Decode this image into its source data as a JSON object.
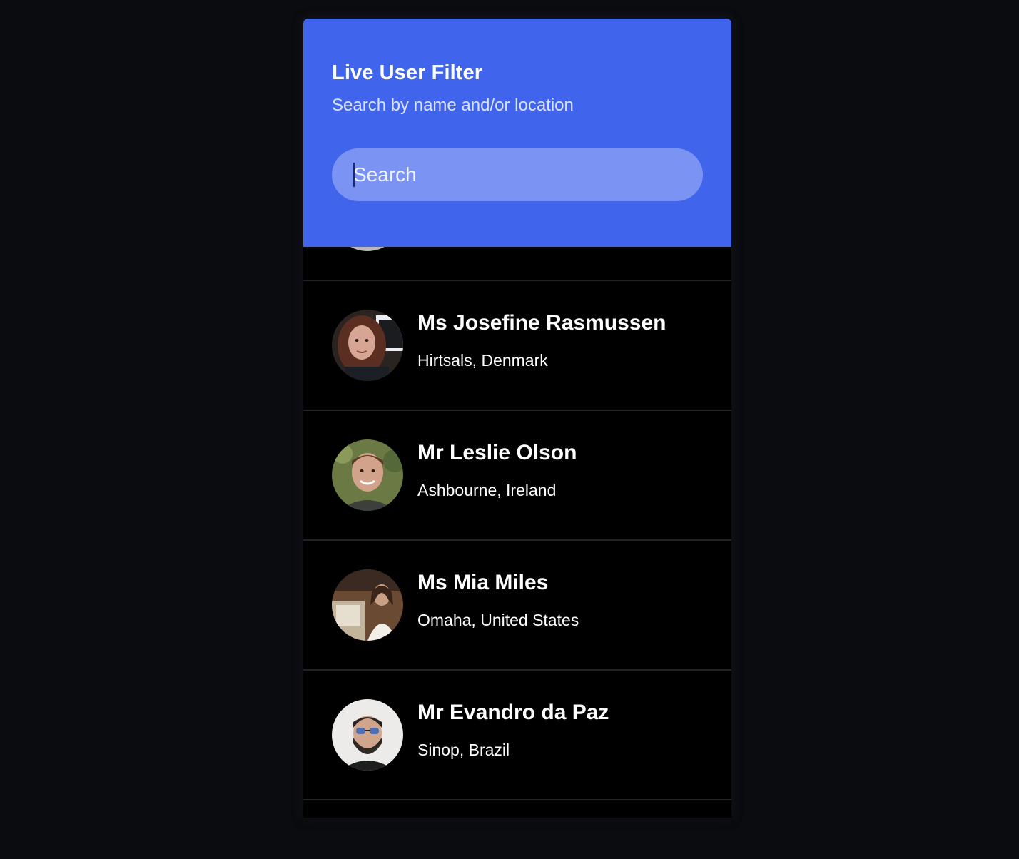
{
  "header": {
    "title": "Live User Filter",
    "subtitle": "Search by name and/or location"
  },
  "search": {
    "placeholder": "Search",
    "value": ""
  },
  "users": [
    {
      "name": "Ms Josefine Rasmussen",
      "location": "Hirtsals, Denmark",
      "avatar_icon": "user-photo"
    },
    {
      "name": "Mr Leslie Olson",
      "location": "Ashbourne, Ireland",
      "avatar_icon": "user-photo"
    },
    {
      "name": "Ms Mia Miles",
      "location": "Omaha, United States",
      "avatar_icon": "user-photo"
    },
    {
      "name": "Mr Evandro da Paz",
      "location": "Sinop, Brazil",
      "avatar_icon": "user-photo"
    }
  ],
  "colors": {
    "page_background": "#0b0c10",
    "header_background": "#4064ec",
    "search_background": "#7b93f3",
    "list_background": "#000000",
    "divider": "#222326"
  }
}
